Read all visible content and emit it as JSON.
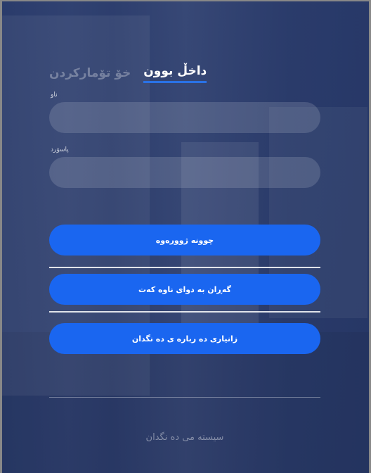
{
  "tabs": {
    "login": "داخڵ بوون",
    "register": "خۆ تۆمارکردن"
  },
  "fields": {
    "username_label": "ناو",
    "password_label": "پاسۆرد",
    "username_value": "",
    "password_value": ""
  },
  "buttons": {
    "enter": "چوونە ژوورەوە",
    "return": "گەڕان بە دوای ناوە کەت",
    "about": "زانیاری دە ربارە ی دە نگدان"
  },
  "footer": {
    "text": "سیستە می دە نگدان"
  },
  "colors": {
    "accent": "#1a66f0",
    "tab_underline": "#2a72e6",
    "overlay": "#223468"
  }
}
